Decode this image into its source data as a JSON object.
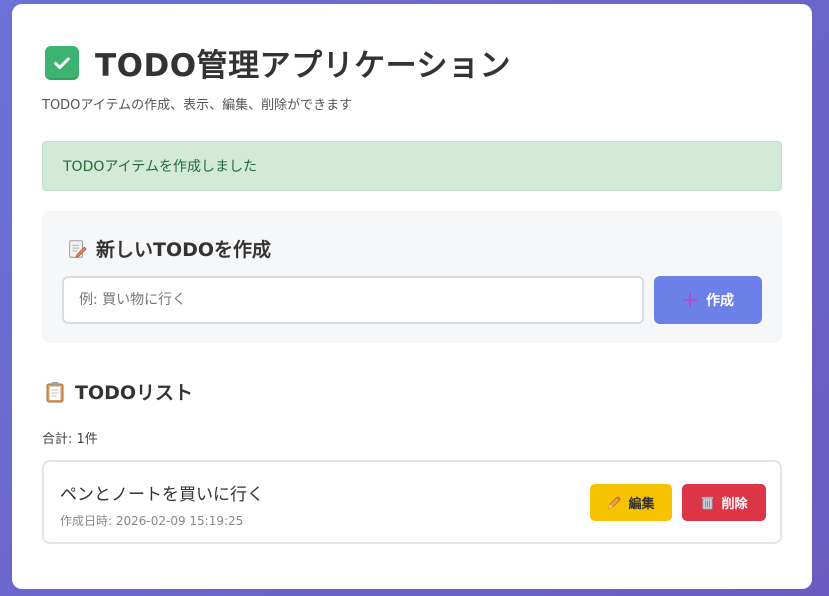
{
  "header": {
    "title": "TODO管理アプリケーション",
    "subtitle": "TODOアイテムの作成、表示、編集、削除ができます",
    "icon": "check-mark-icon"
  },
  "alert": {
    "message": "TODOアイテムを作成しました",
    "status": "success",
    "color": "#d4ead9"
  },
  "create_form": {
    "title": "新しいTODOを作成",
    "icon": "memo-icon",
    "input_value": "",
    "input_placeholder": "例: 買い物に行く",
    "button_label": "作成",
    "button_icon": "plus-icon",
    "button_color": "#6b80e8"
  },
  "list": {
    "title": "TODOリスト",
    "icon": "clipboard-icon",
    "count_text": "合計: 1件",
    "items": [
      {
        "text": "ペンとノートを買いに行く",
        "created": "作成日時: 2026-02-09 15:19:25",
        "edit_label": "編集",
        "delete_label": "削除"
      }
    ]
  },
  "colors": {
    "edit": "#f7c200",
    "delete": "#dc3545",
    "background_gradient": "#6b71d6"
  }
}
